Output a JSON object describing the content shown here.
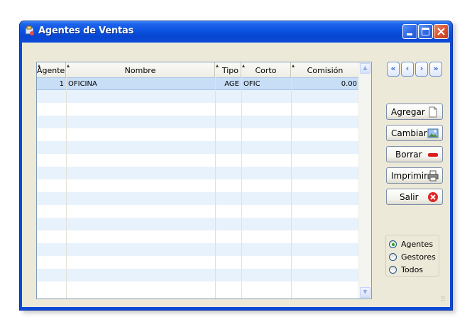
{
  "window": {
    "title": "Agentes de Ventas"
  },
  "grid": {
    "columns": [
      "Agente",
      "Nombre",
      "Tipo",
      "Corto",
      "Comisión"
    ],
    "rows": [
      {
        "agente": "1",
        "nombre": "OFICINA",
        "tipo": "AGE",
        "corto": "OFIC",
        "comision": "0.00"
      }
    ]
  },
  "nav": {
    "first": "«",
    "prev": "‹",
    "next": "›",
    "last": "»"
  },
  "buttons": {
    "agregar": "Agregar",
    "cambiar": "Cambiar",
    "borrar": "Borrar",
    "imprimir": "Imprimir",
    "salir": "Salir"
  },
  "filter": {
    "options": [
      "Agentes",
      "Gestores",
      "Todos"
    ],
    "selected": "Agentes"
  },
  "colors": {
    "titlebar": "#0a4ad6",
    "selected_row": "#c8def6",
    "alt_row": "#e8f2fc",
    "close_btn": "#d8532f"
  }
}
